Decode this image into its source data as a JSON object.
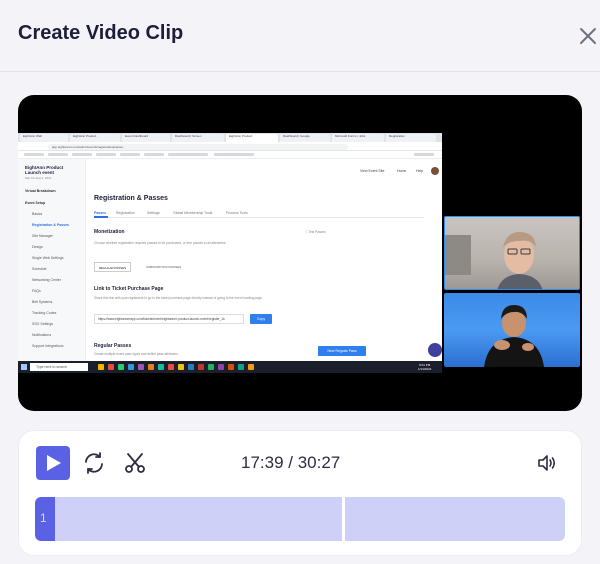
{
  "dialog": {
    "title": "Create Video Clip"
  },
  "screen": {
    "tabs": [
      "EightAnn Wall",
      "EightAnn Product",
      "Event Dashboard",
      "Dashboard | Screen",
      "EightAnn Product",
      "Dashboard | Google",
      "Microsoft Forms | Jobs",
      "Registration"
    ],
    "url": "app.eightanner.com/admin/events/registration/passes",
    "app": {
      "brand": "EightAnn Product Launch event",
      "brand_date": "Mar 19-Aug 2, 2021",
      "sidebar": [
        {
          "label": "Virtual Breakdown",
          "kind": "section"
        },
        {
          "label": "Event Setup",
          "kind": "section"
        },
        {
          "label": "Basics",
          "kind": "item"
        },
        {
          "label": "Registration & Passes",
          "kind": "active"
        },
        {
          "label": "Site Manager",
          "kind": "item"
        },
        {
          "label": "Design",
          "kind": "item"
        },
        {
          "label": "Single Web Settings",
          "kind": "item"
        },
        {
          "label": "Schedule",
          "kind": "item"
        },
        {
          "label": "Networking Center",
          "kind": "item"
        },
        {
          "label": "FAQs",
          "kind": "item"
        },
        {
          "label": "Bell Systems",
          "kind": "item"
        },
        {
          "label": "Tracking Codes",
          "kind": "item"
        },
        {
          "label": "SSO Settings",
          "kind": "item"
        },
        {
          "label": "Notifications",
          "kind": "item"
        },
        {
          "label": "Support Integrations",
          "kind": "item"
        }
      ],
      "topbar": [
        "View Event Site",
        "Home",
        "Help"
      ],
      "page_title": "Registration & Passes",
      "subtabs": [
        "Passes",
        "Registration",
        "Settings",
        "Global Membership Tools",
        "Process Tools"
      ],
      "monetization_title": "Monetization",
      "monetization_side": "i. Test Passes",
      "monetization_text": "Choose whether registration requires passes to be purchased, or free passes to all attendees.",
      "pills": [
        "REGULAR PASSES",
        "SUBSCRIPTION PASSES"
      ],
      "link_title": "Link to Ticket Purchase Page",
      "link_text": "Share this link with your registrants to go to the ticket purchase page directly instead of going to the event landing page.",
      "link_url": "https://www.eightannerapp.com/tickets/event/eightanner-product-launch-event/register_1k",
      "copy_label": "Copy",
      "regular_title": "Regular Passes",
      "regular_text": "Create multiple event pass types and define pass attributes.",
      "new_pass_label": "New Regular Pass"
    },
    "taskbar": {
      "search": "Type here to search",
      "time": "8:01 PM",
      "date": "1/14/2022"
    }
  },
  "player": {
    "current_time": "17:39",
    "duration": "30:27",
    "time_display": "17:39 / 30:27",
    "clip_label": "1",
    "progress": 0.58
  },
  "colors": {
    "accent": "#5b61e5",
    "timeline": "#cfd0f7",
    "title": "#1d1f3a"
  }
}
